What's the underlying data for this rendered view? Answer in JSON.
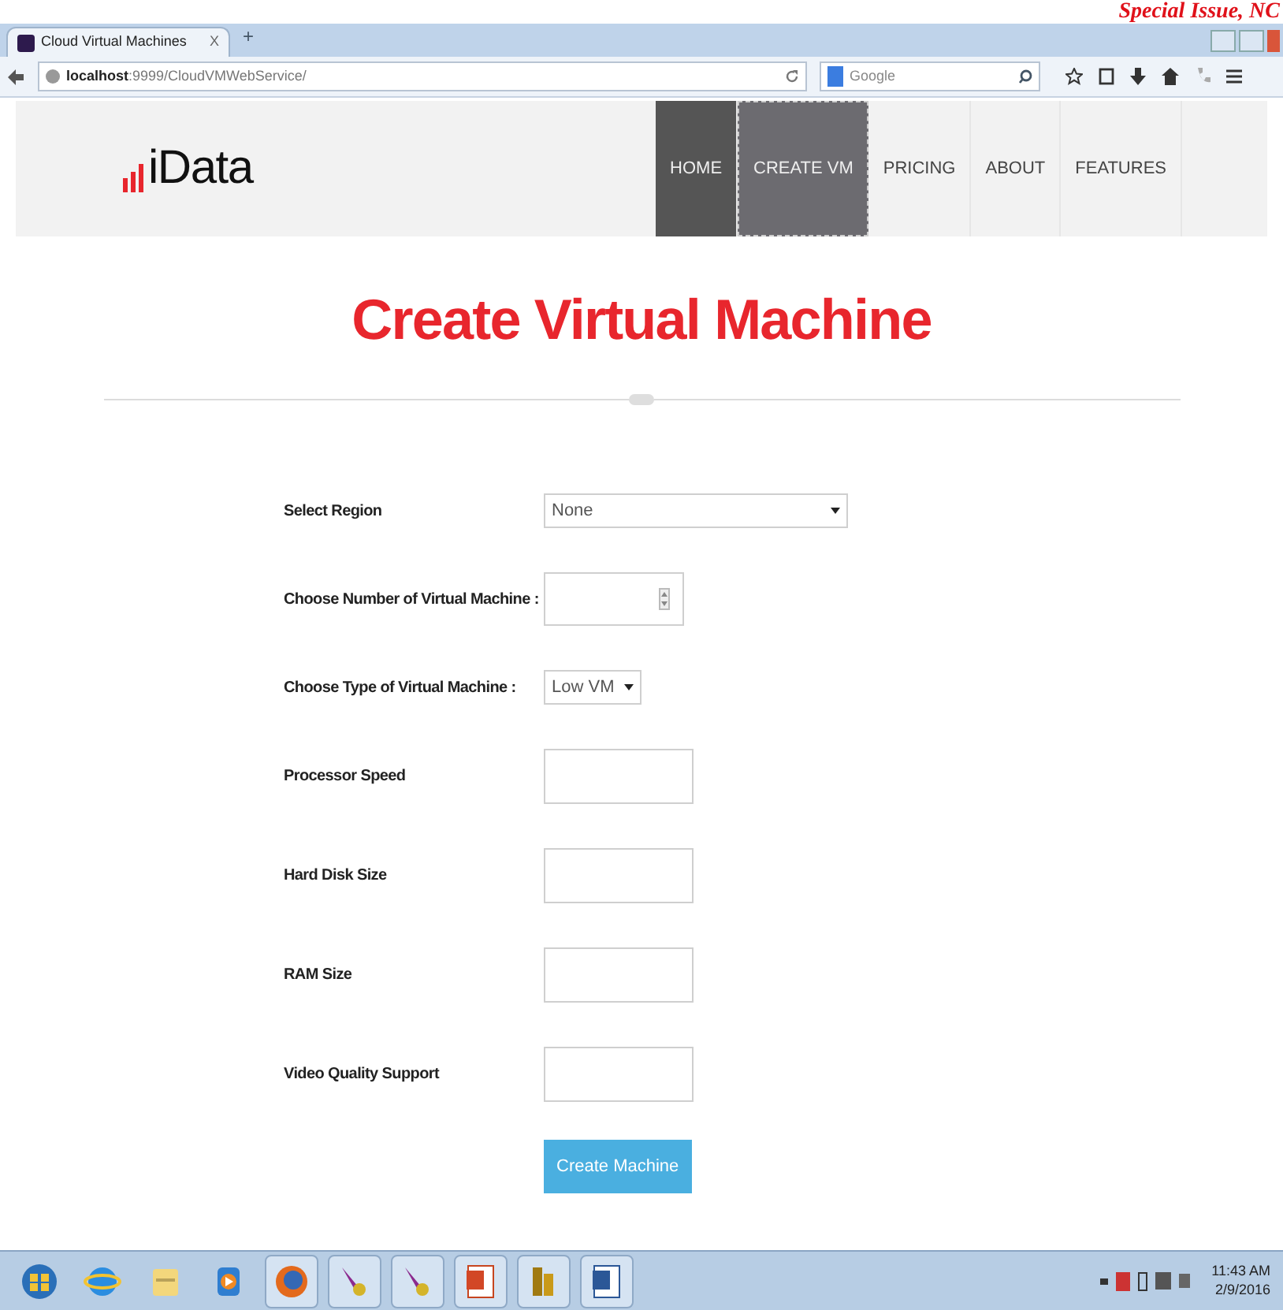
{
  "header_overlay": "Special Issue, NC",
  "browser": {
    "tab_title": "Cloud Virtual Machines",
    "tab_close": "X",
    "new_tab": "+",
    "url_host": "localhost",
    "url_rest": ":9999/CloudVMWebService/",
    "search_placeholder": "Google"
  },
  "site": {
    "logo": "iData",
    "nav": [
      {
        "label": "HOME",
        "selected": true,
        "focused": false
      },
      {
        "label": "CREATE VM",
        "selected": false,
        "focused": true
      },
      {
        "label": "PRICING",
        "selected": false,
        "focused": false
      },
      {
        "label": "ABOUT",
        "selected": false,
        "focused": false
      },
      {
        "label": "FEATURES",
        "selected": false,
        "focused": false
      }
    ],
    "heading": "Create Virtual Machine",
    "form": [
      {
        "label": "Select Region",
        "kind": "select",
        "value": "None"
      },
      {
        "label": "Choose Number of Virtual Machine :",
        "kind": "number"
      },
      {
        "label": "Choose Type of Virtual Machine :",
        "kind": "smallselect",
        "value": "Low VM"
      },
      {
        "label": "Processor Speed",
        "kind": "text"
      },
      {
        "label": "Hard Disk Size",
        "kind": "text"
      },
      {
        "label": "RAM Size",
        "kind": "text"
      },
      {
        "label": "Video Quality Support",
        "kind": "text"
      }
    ],
    "submit": "Create Machine"
  },
  "taskbar": {
    "apps": [
      {
        "kind": "start",
        "running": false
      },
      {
        "kind": "ie",
        "running": false
      },
      {
        "kind": "folder",
        "running": false
      },
      {
        "kind": "media",
        "running": false
      },
      {
        "kind": "firefox",
        "running": true
      },
      {
        "kind": "feather",
        "running": true
      },
      {
        "kind": "feather",
        "running": true
      },
      {
        "kind": "powerpoint",
        "running": true
      },
      {
        "kind": "coins",
        "running": true
      },
      {
        "kind": "word",
        "running": true
      }
    ],
    "time": "11:43 AM",
    "date": "2/9/2016"
  }
}
